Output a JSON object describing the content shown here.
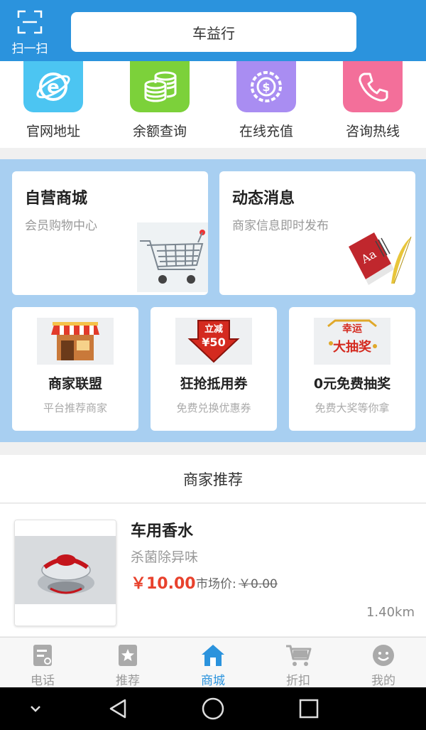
{
  "header": {
    "scan_label": "扫一扫",
    "title": "车益行"
  },
  "quick_links": [
    {
      "label": "官网地址",
      "icon": "browser-e-icon",
      "color": "#4cc5f2"
    },
    {
      "label": "余额查询",
      "icon": "coins-icon",
      "color": "#7cd13a"
    },
    {
      "label": "在线充值",
      "icon": "coin-recharge-icon",
      "color": "#a98df2"
    },
    {
      "label": "咨询热线",
      "icon": "phone-icon",
      "color": "#f36f9a"
    }
  ],
  "features": {
    "mall": {
      "title": "自营商城",
      "subtitle": "会员购物中心"
    },
    "news": {
      "title": "动态消息",
      "subtitle": "商家信息即时发布"
    },
    "small": [
      {
        "title": "商家联盟",
        "subtitle": "平台推荐商家",
        "icon": "storefront-icon"
      },
      {
        "title": "狂抢抵用券",
        "subtitle": "免费兑换优惠券",
        "icon": "coupon-arrow-icon",
        "badge_top": "立减",
        "badge_bottom": "¥50"
      },
      {
        "title": "0元免费抽奖",
        "subtitle": "免费大奖等你拿",
        "icon": "lottery-icon",
        "badge_top": "幸运",
        "badge_bottom": "大抽奖"
      }
    ]
  },
  "recommend": {
    "header": "商家推荐",
    "product": {
      "name": "车用香水",
      "desc": "杀菌除异味",
      "price": "￥10.00",
      "market_label": "市场价:",
      "market_price": "￥0.00",
      "distance": "1.40km"
    }
  },
  "tabs": [
    {
      "label": "电话",
      "icon": "phone-book-icon",
      "active": false
    },
    {
      "label": "推荐",
      "icon": "star-bookmark-icon",
      "active": false
    },
    {
      "label": "商城",
      "icon": "home-icon",
      "active": true
    },
    {
      "label": "折扣",
      "icon": "cart-icon",
      "active": false
    },
    {
      "label": "我的",
      "icon": "smile-icon",
      "active": false
    }
  ],
  "colors": {
    "primary": "#2b93dd",
    "price": "#e8412c",
    "feature_bg": "#a8cff1"
  }
}
